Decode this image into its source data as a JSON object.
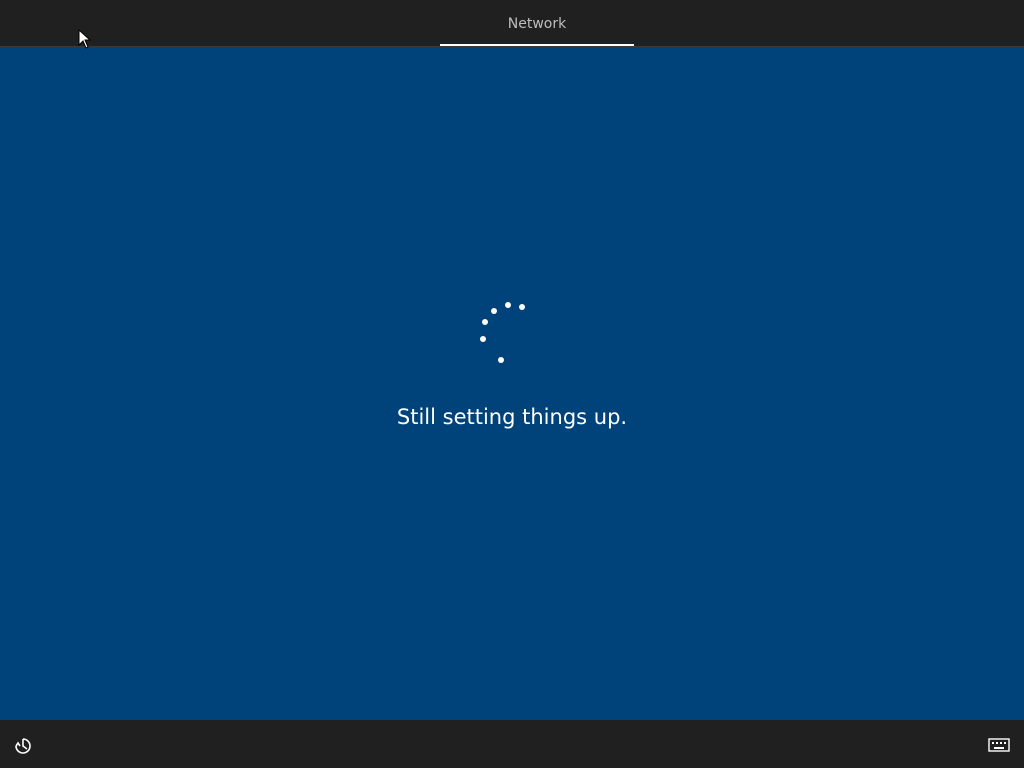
{
  "header": {
    "tabs": [
      {
        "label": "Network",
        "active": true
      }
    ]
  },
  "main": {
    "status_text": "Still setting things up.",
    "background_color": "#00437a",
    "spinner_icon": "loading-dots-icon"
  },
  "footer": {
    "left_icon": "ease-of-access-icon",
    "right_icon": "keyboard-icon"
  },
  "colors": {
    "bar_background": "#202020",
    "accent": "#ffffff",
    "tab_text": "#bdbdbd"
  }
}
